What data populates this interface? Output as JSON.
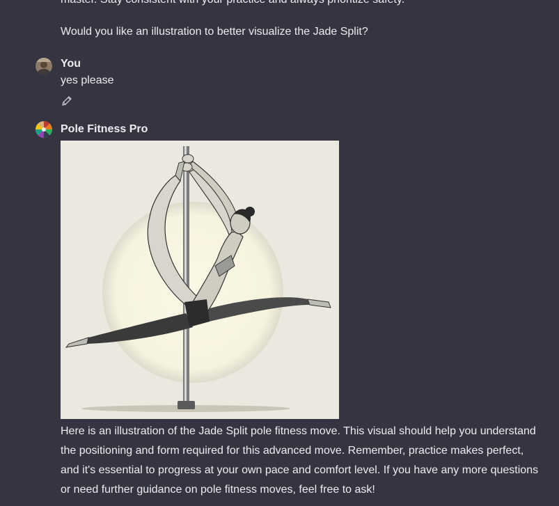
{
  "previous_message": {
    "cut_off_line": "master. Stay consistent with your practice and always prioritize safety.",
    "question": "Would you like an illustration to better visualize the Jade Split?"
  },
  "user_message": {
    "author": "You",
    "text": "yes please",
    "edit_icon": "pencil-icon"
  },
  "assistant_message": {
    "author": "Pole Fitness Pro",
    "image_alt": "Illustration of the Jade Split pole fitness move",
    "text": "Here is an illustration of the Jade Split pole fitness move. This visual should help you understand the positioning and form required for this advanced move. Remember, practice makes perfect, and it's essential to progress at your own pace and comfort level. If you have any more questions or need further guidance on pole fitness moves, feel free to ask!"
  },
  "colors": {
    "background": "#343541",
    "text": "#ececf1",
    "image_bg": "#ebe9df"
  }
}
